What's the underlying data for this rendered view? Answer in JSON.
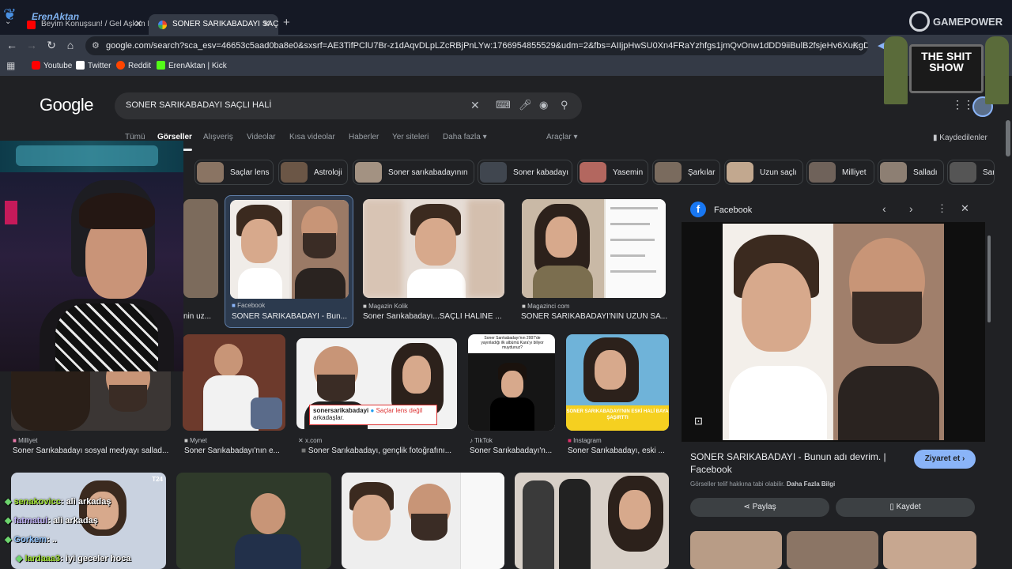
{
  "tabs": [
    {
      "label": "Beyim Konuşsun! / Gel Aşkım B..."
    },
    {
      "label": "SONER SARIKABADAYI SAÇLI HA..."
    }
  ],
  "new_tab_label": "+",
  "url": "google.com/search?sca_esv=46653c5aad0ba8e0&sxsrf=AE3TifPClU7Br-z1dAqvDLpLZcRBjPnLYw:1766954855529&udm=2&fbs=AIIjpHwSU0Xn4FRaYzhfgs1jmQvOnw1dDD9iiBulB2fsjeHv6XuKgDzU9KpxZMcpsjQNb1WcU...",
  "bookmarks": [
    {
      "label": "Youtube",
      "color": "#ff0000"
    },
    {
      "label": "Twitter",
      "color": "#ffffff"
    },
    {
      "label": "Reddit",
      "color": "#ff4500"
    },
    {
      "label": "ErenAktan | Kick",
      "color": "#53fc18"
    }
  ],
  "google_logo": "Google",
  "search": {
    "query": "SONER SARIKABADAYI SAÇLI HALİ"
  },
  "nav_tabs": [
    "Tümü",
    "Görseller",
    "Alışveriş",
    "Videolar",
    "Kısa videolar",
    "Haberler",
    "Yer siteleri",
    "Daha fazla ▾"
  ],
  "tools_label": "Araçlar ▾",
  "saved_label": "Kaydedilenler",
  "chips": [
    "Saçlar lens",
    "Astroloji",
    "Soner sarıkabadayının",
    "Soner kabadayı",
    "Yasemin",
    "Şarkılar",
    "Uzun saçlı",
    "Milliyet",
    "Salladı",
    "Sar"
  ],
  "results_row1": [
    {
      "source": "Facebook",
      "caption": "SONER SARIKABADAYI - Bun..."
    },
    {
      "source": "Magazin Kolik",
      "caption": "Soner Sarıkabadayı...SAÇLI HALİNE ..."
    },
    {
      "source": "Magazinci com",
      "caption": "SONER SARIKABADAYI'NIN UZUN SA..."
    }
  ],
  "partial_caption": "nin uz...",
  "results_row2": [
    {
      "source": "Milliyet",
      "caption": "Soner Sarıkabadayı sosyal medyayı sallad..."
    },
    {
      "source": "Mynet",
      "caption": "Soner Sarıkabadayı'nın e..."
    },
    {
      "source": "x.com",
      "caption": "Soner Sarıkabadayı, gençlik fotoğrafını..."
    },
    {
      "source": "TikTok",
      "caption": "Soner Sarıkabadayı'n..."
    },
    {
      "source": "Instagram",
      "caption": "Soner Sarıkabadayı, eski ..."
    }
  ],
  "tweet_overlay": {
    "user": "sonersarikabadayi",
    "text": "Saçlar lens değil",
    "text2": "arkadaşlar."
  },
  "tiktok_text": "Soner Sarıkabadayı'nın 2007'de yayınladığı ilk albümü Kara'yı biliyor muydunuz?",
  "insta_banner": "SONER SARIKABADAYI'NIN ESKİ HALİ BAYA ŞAŞIRTTI",
  "t24_badge": "T24",
  "panel": {
    "source": "Facebook",
    "title": "SONER SARIKABADAYI - Bunun adı devrim. | Facebook",
    "visit_label": "Ziyaret et ›",
    "copyright": "Görseller telif hakkına tabi olabilir.",
    "more_info": "Daha Fazla Bilgi",
    "share_label": "Paylaş",
    "save_label": "Kaydet"
  },
  "overlay": {
    "channel": "ErenAktan",
    "sponsor": "GAMEPOWER",
    "show_title": "THE SHIT SHOW"
  },
  "chat": [
    {
      "user": "senakovicc",
      "msg": ": ali arkadaş",
      "color": "#a3e635"
    },
    {
      "user": "fatmatul",
      "msg": ": ali arkadaş",
      "color": "#c4b5fd"
    },
    {
      "user": "Gorkem",
      "msg": ": ..",
      "color": "#93c5fd"
    },
    {
      "user": "lardaaa3",
      "msg": ": iyi geceler hoca",
      "color": "#a3e635"
    }
  ]
}
